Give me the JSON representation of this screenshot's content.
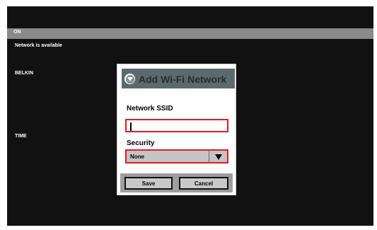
{
  "status": {
    "label": "ON",
    "message": "Network is available"
  },
  "networks": {
    "items": [
      "BELKIN",
      "TIME"
    ]
  },
  "dialog": {
    "title": "Add Wi-Fi Network",
    "ssid_label": "Network SSID",
    "ssid_value": "",
    "security_label": "Security",
    "security_value": "None",
    "save_label": "Save",
    "cancel_label": "Cancel"
  },
  "colors": {
    "screen_bg": "#111111",
    "status_bar": "#8a8a8a",
    "dialog_header": "#5b6b6d",
    "highlight_border": "#e01b22",
    "button_bar": "#9e9e9e"
  },
  "icons": {
    "header": "dropdown-circle-icon",
    "select_arrow": "triangle-down-icon"
  }
}
